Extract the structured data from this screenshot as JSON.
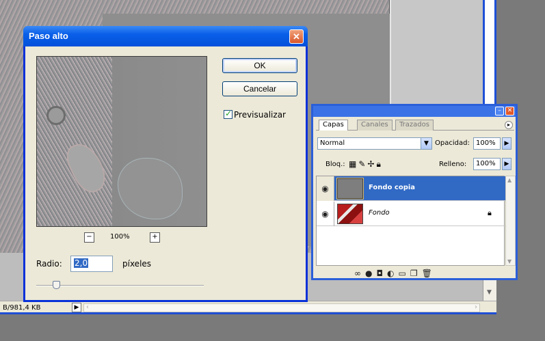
{
  "dialog": {
    "title": "Paso alto",
    "ok_label": "OK",
    "cancel_label": "Cancelar",
    "preview_label": "Previsualizar",
    "preview_checked": true,
    "zoom_level": "100%",
    "radius_label": "Radio:",
    "radius_value": "2,0",
    "radius_unit": "píxeles",
    "slider_fraction": 0.12
  },
  "layers_panel": {
    "tabs": [
      {
        "label": "Capas",
        "active": true
      },
      {
        "label": "Canales",
        "active": false
      },
      {
        "label": "Trazados",
        "active": false
      }
    ],
    "blend_mode": "Normal",
    "opacity_label": "Opacidad:",
    "opacity_value": "100%",
    "lock_label": "Bloq.:",
    "fill_label": "Relleno:",
    "fill_value": "100%",
    "layers": [
      {
        "name": "Fondo copia",
        "selected": true,
        "visible": true,
        "thumbnail": "grey-fill"
      },
      {
        "name": "Fondo",
        "selected": false,
        "visible": true,
        "thumbnail": "photo",
        "locked": true
      }
    ],
    "action_icons": [
      "link-icon",
      "style-icon",
      "mask-icon",
      "adjustment-icon",
      "folder-icon",
      "new-layer-icon",
      "trash-icon"
    ]
  },
  "statusbar": {
    "doc_size": "B/981,4 KB"
  },
  "icons": [
    "close-icon",
    "eye-icon",
    "lock-icon",
    "move-icon",
    "brush-icon",
    "checker-icon",
    "chevron-down-icon",
    "chevron-right-icon",
    "zoom-in-icon",
    "zoom-out-icon"
  ],
  "colors": {
    "xp_title_blue": "#0a5fe8",
    "selection_blue": "#316ac5",
    "dialog_bg": "#ece9d8",
    "close_orange": "#d9562a"
  }
}
